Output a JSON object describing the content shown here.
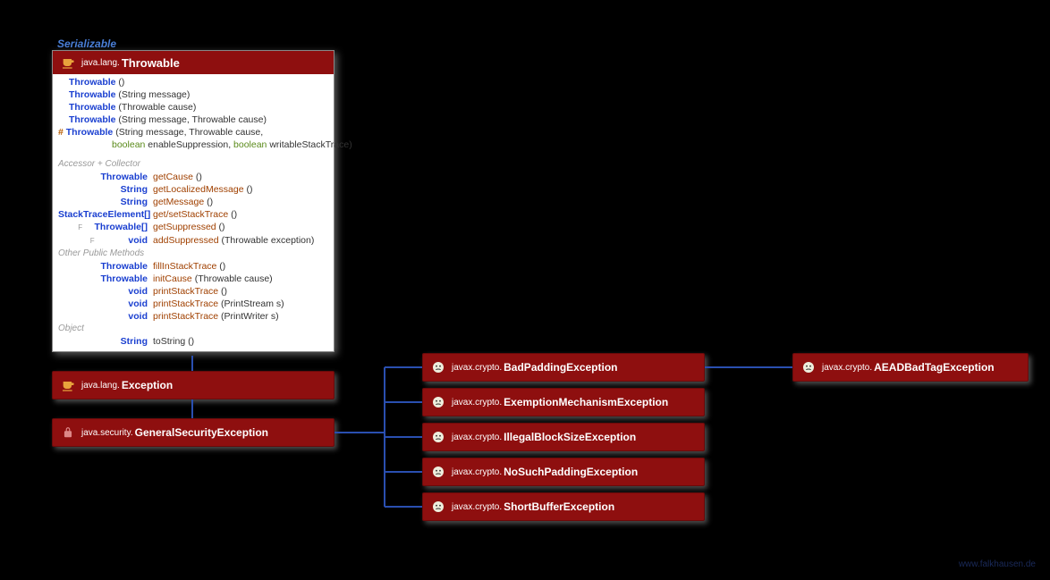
{
  "serializable_label": "Serializable",
  "throwable": {
    "pkg": "java.lang.",
    "cls": "Throwable",
    "constructors": [
      {
        "sig": "Throwable",
        "args": " ()"
      },
      {
        "sig": "Throwable",
        "args": " (String message)"
      },
      {
        "sig": "Throwable",
        "args": " (Throwable cause)"
      },
      {
        "sig": "Throwable",
        "args": " (String message, Throwable cause)"
      },
      {
        "sig": "Throwable",
        "args": " (String message, Throwable cause,",
        "protected": true
      }
    ],
    "ctor_cont": "boolean enableSuppression, boolean writableStackTrace)",
    "sec_accessor": "Accessor + Collector",
    "accessor_rows": [
      {
        "ret": "Throwable",
        "name": "getCause",
        "args": " ()"
      },
      {
        "ret": "String",
        "name": "getLocalizedMessage",
        "args": " ()"
      },
      {
        "ret": "String",
        "name": "getMessage",
        "args": " ()"
      },
      {
        "ret": "StackTraceElement[]",
        "name": "get/setStackTrace",
        "args": " ()"
      },
      {
        "ret": "Throwable[]",
        "name": "getSuppressed",
        "args": " ()",
        "final": true
      },
      {
        "ret": "void",
        "name": "addSuppressed",
        "args": " (Throwable exception)",
        "final": true
      }
    ],
    "sec_other": "Other Public Methods",
    "other_rows": [
      {
        "ret": "Throwable",
        "name": "fillInStackTrace",
        "args": " ()"
      },
      {
        "ret": "Throwable",
        "name": "initCause",
        "args": " (Throwable cause)"
      },
      {
        "ret": "void",
        "name": "printStackTrace",
        "args": " ()"
      },
      {
        "ret": "void",
        "name": "printStackTrace",
        "args": " (PrintStream s)"
      },
      {
        "ret": "void",
        "name": "printStackTrace",
        "args": " (PrintWriter s)"
      }
    ],
    "sec_object": "Object",
    "object_rows": [
      {
        "ret": "String",
        "name": "toString",
        "args": " ()",
        "plain": true
      }
    ]
  },
  "exception": {
    "pkg": "java.lang.",
    "cls": "Exception"
  },
  "gse": {
    "pkg": "java.security.",
    "cls": "GeneralSecurityException"
  },
  "children": {
    "bpe": {
      "pkg": "javax.crypto.",
      "cls": "BadPaddingException"
    },
    "eme": {
      "pkg": "javax.crypto.",
      "cls": "ExemptionMechanismException"
    },
    "ibse": {
      "pkg": "javax.crypto.",
      "cls": "IllegalBlockSizeException"
    },
    "nspe": {
      "pkg": "javax.crypto.",
      "cls": "NoSuchPaddingException"
    },
    "sbe": {
      "pkg": "javax.crypto.",
      "cls": "ShortBufferException"
    },
    "aead": {
      "pkg": "javax.crypto.",
      "cls": "AEADBadTagException"
    }
  },
  "watermark": "www.falkhausen.de"
}
